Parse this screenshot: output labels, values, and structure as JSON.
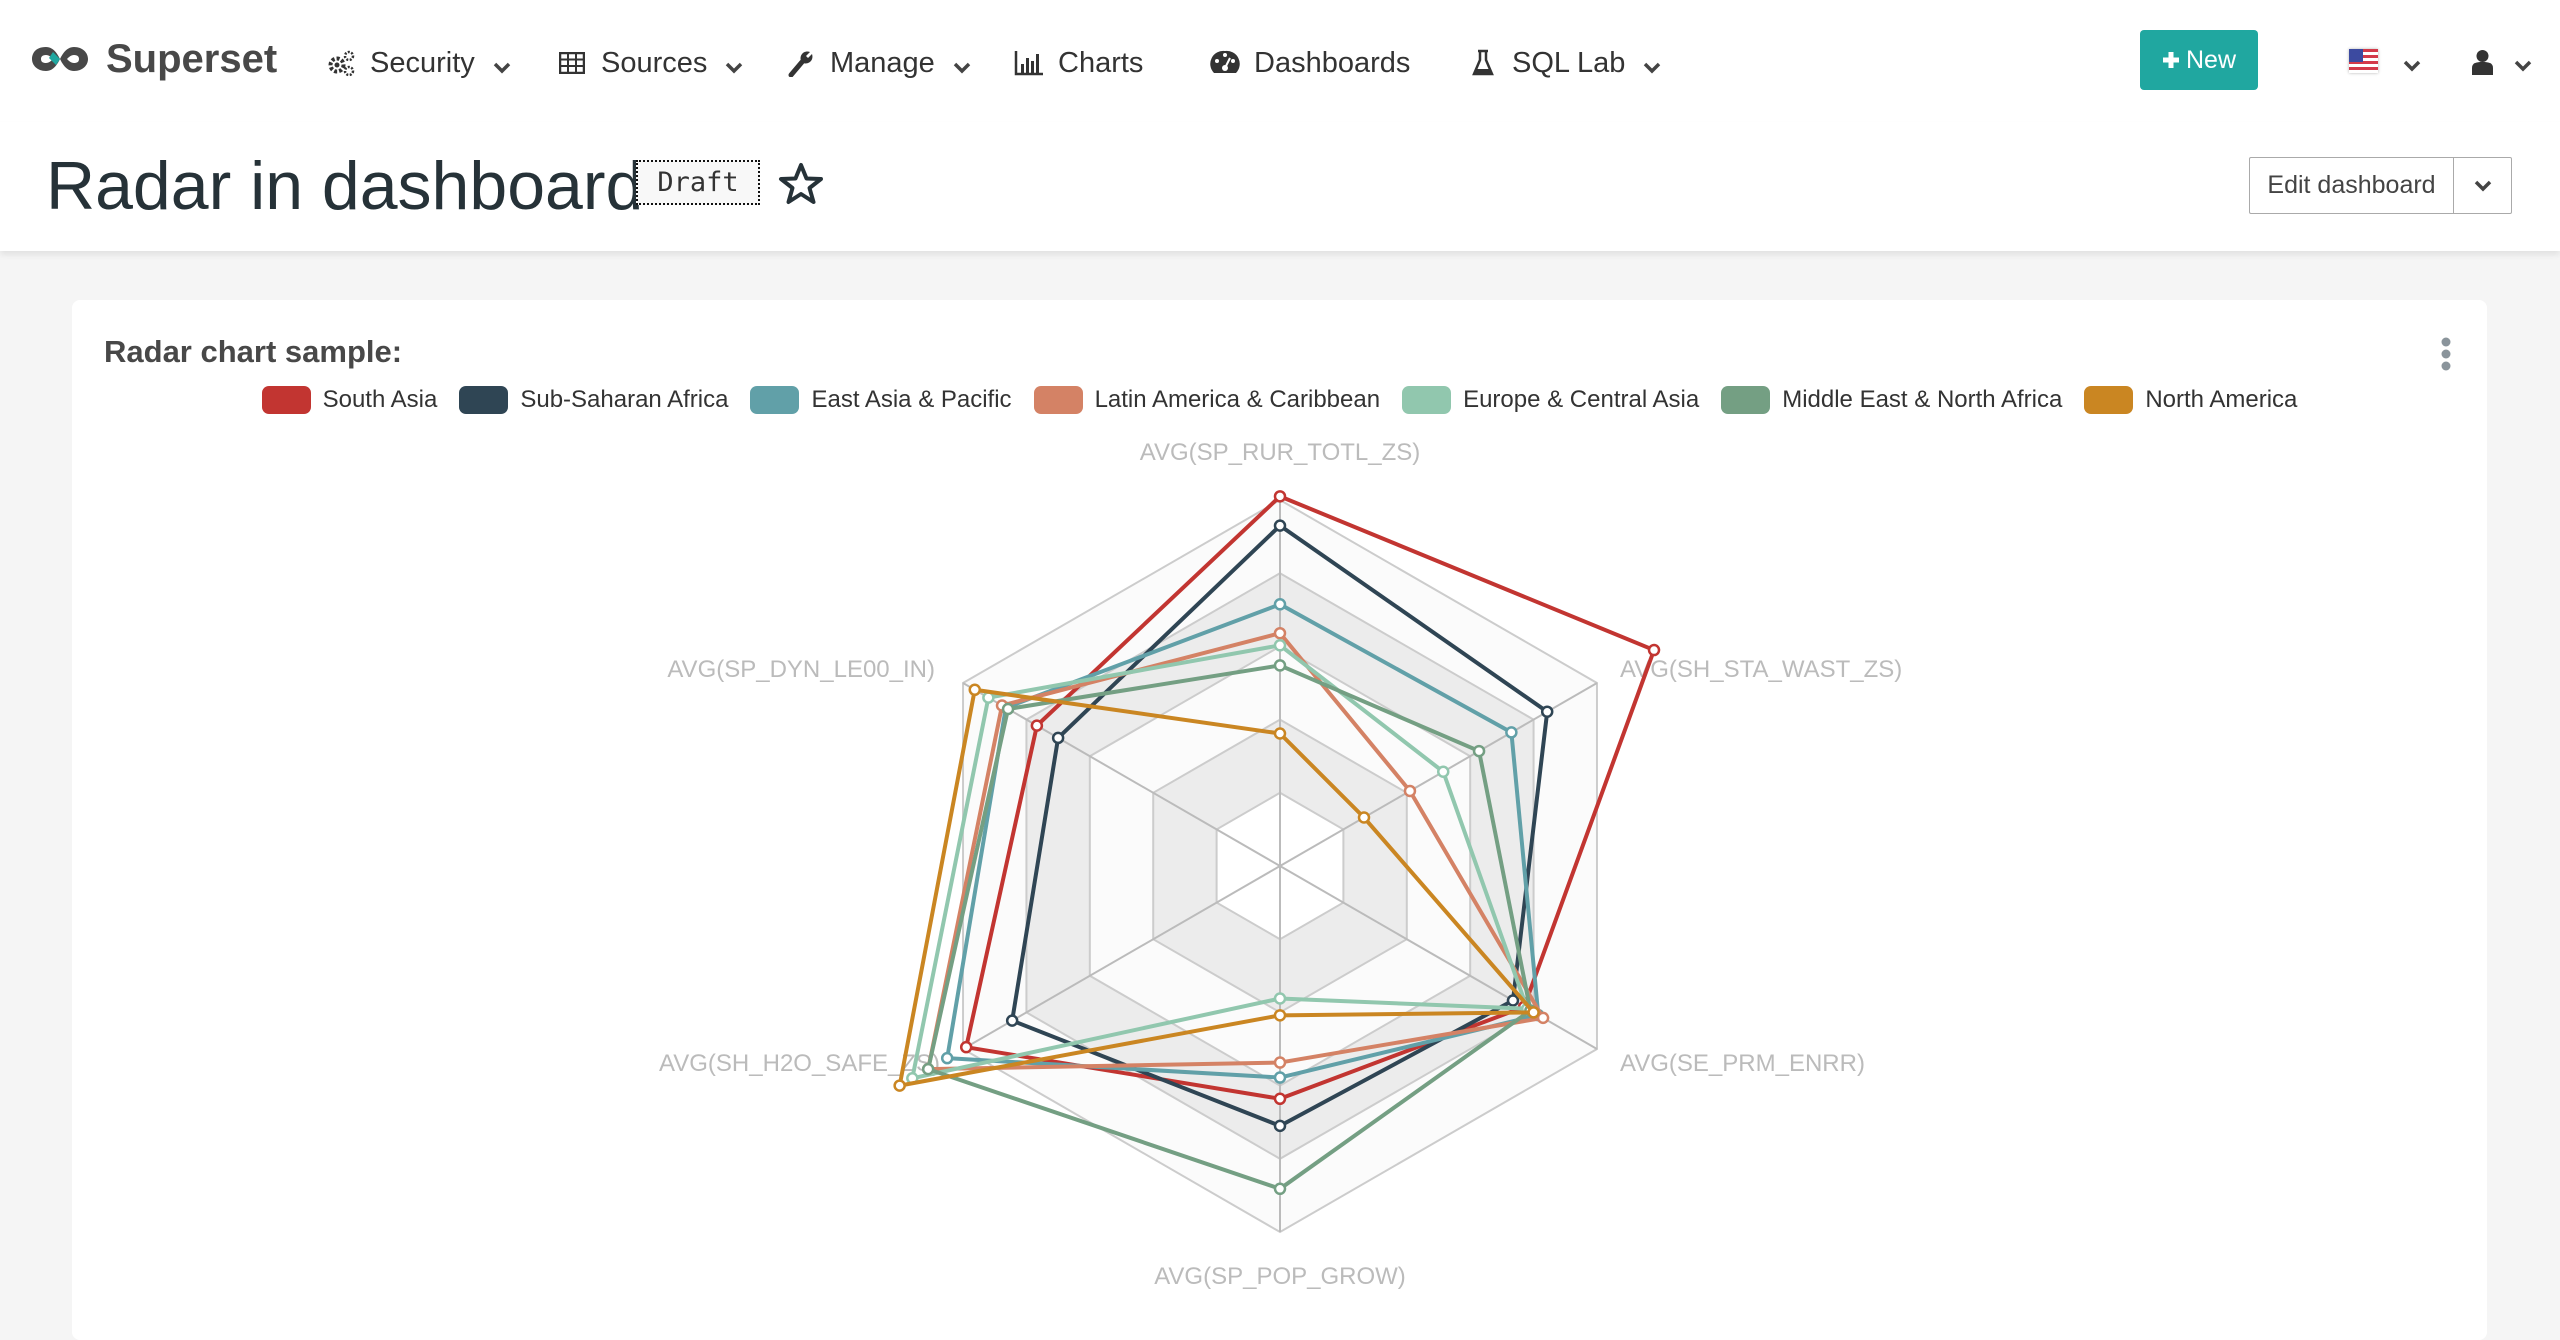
{
  "navbar": {
    "brand": "Superset",
    "items": [
      {
        "label": "Security",
        "icon": "gears-icon",
        "dropdown": true
      },
      {
        "label": "Sources",
        "icon": "table-icon",
        "dropdown": true
      },
      {
        "label": "Manage",
        "icon": "wrench-icon",
        "dropdown": true
      },
      {
        "label": "Charts",
        "icon": "bar-chart-icon",
        "dropdown": false
      },
      {
        "label": "Dashboards",
        "icon": "dashboard-icon",
        "dropdown": false
      },
      {
        "label": "SQL Lab",
        "icon": "flask-icon",
        "dropdown": true
      }
    ],
    "new_button": "New",
    "language_flag": "us-flag-icon",
    "user_icon": "user-icon"
  },
  "header": {
    "title": "Radar in dashboard",
    "status_badge": "Draft",
    "edit_button": "Edit dashboard"
  },
  "colors": {
    "brand_accent": "#20a7a0"
  },
  "chart_data": {
    "type": "radar",
    "title": "Radar chart sample:",
    "legend_position": "top-center",
    "indicators": [
      "AVG(SP_RUR_TOTL_ZS)",
      "AVG(SH_STA_WAST_ZS)",
      "AVG(SE_PRM_ENRR)",
      "AVG(SP_POP_GROW)",
      "AVG(SH_H2O_SAFE_ZS)",
      "AVG(SP_DYN_LE00_IN)"
    ],
    "split_number": 5,
    "value_scale": "fraction of each axis maximum (1.0 = outer ring)",
    "series": [
      {
        "name": "South Asia",
        "color": "#c23531",
        "values": [
          1.01,
          1.18,
          0.77,
          0.636,
          0.99,
          0.767
        ]
      },
      {
        "name": "Sub-Saharan Africa",
        "color": "#2f4554",
        "values": [
          0.93,
          0.843,
          0.735,
          0.71,
          0.845,
          0.7
        ]
      },
      {
        "name": "East Asia & Pacific",
        "color": "#61a0a8",
        "values": [
          0.715,
          0.73,
          0.815,
          0.578,
          1.05,
          0.865
        ]
      },
      {
        "name": "Latin America & Caribbean",
        "color": "#d48265",
        "values": [
          0.636,
          0.41,
          0.83,
          0.537,
          1.11,
          0.877
        ]
      },
      {
        "name": "Europe & Central Asia",
        "color": "#91c7ae",
        "values": [
          0.603,
          0.515,
          0.78,
          0.362,
          1.16,
          0.92
        ]
      },
      {
        "name": "Middle East & North Africa",
        "color": "#749f83",
        "values": [
          0.548,
          0.628,
          0.79,
          0.882,
          1.11,
          0.858
        ]
      },
      {
        "name": "North America",
        "color": "#ca8622",
        "values": [
          0.362,
          0.265,
          0.8,
          0.408,
          1.2,
          0.963
        ]
      }
    ]
  }
}
